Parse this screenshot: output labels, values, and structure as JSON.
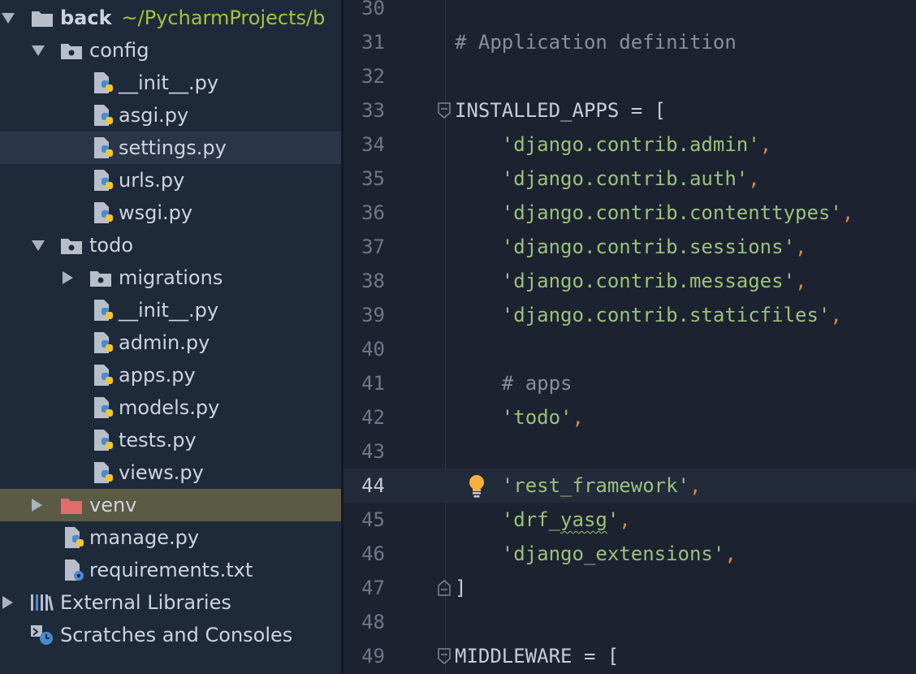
{
  "project_tree": {
    "root": {
      "name": "back",
      "path": "~/PycharmProjects/b"
    },
    "config": {
      "name": "config",
      "files": [
        "__init__.py",
        "asgi.py",
        "settings.py",
        "urls.py",
        "wsgi.py"
      ]
    },
    "todo": {
      "name": "todo",
      "migrations": "migrations",
      "files": [
        "__init__.py",
        "admin.py",
        "apps.py",
        "models.py",
        "tests.py",
        "views.py"
      ]
    },
    "venv": "venv",
    "root_files": [
      "manage.py",
      "requirements.txt"
    ],
    "external_libraries": "External Libraries",
    "scratches": "Scratches and Consoles",
    "selected_file": "settings.py"
  },
  "editor": {
    "current_line": "44",
    "lines": [
      {
        "num": "30",
        "tokens": []
      },
      {
        "num": "31",
        "tokens": [
          {
            "t": "# Application definition",
            "c": "comment"
          }
        ]
      },
      {
        "num": "32",
        "tokens": []
      },
      {
        "num": "33",
        "tokens": [
          {
            "t": "INSTALLED_APPS = [",
            "c": "plain"
          }
        ]
      },
      {
        "num": "34",
        "tokens": [
          {
            "t": "    ",
            "c": "plain"
          },
          {
            "t": "'django.contrib.admin'",
            "c": "str"
          },
          {
            "t": ",",
            "c": "punct"
          }
        ]
      },
      {
        "num": "35",
        "tokens": [
          {
            "t": "    ",
            "c": "plain"
          },
          {
            "t": "'django.contrib.auth'",
            "c": "str"
          },
          {
            "t": ",",
            "c": "punct"
          }
        ]
      },
      {
        "num": "36",
        "tokens": [
          {
            "t": "    ",
            "c": "plain"
          },
          {
            "t": "'django.contrib.contenttypes'",
            "c": "str"
          },
          {
            "t": ",",
            "c": "punct"
          }
        ]
      },
      {
        "num": "37",
        "tokens": [
          {
            "t": "    ",
            "c": "plain"
          },
          {
            "t": "'django.contrib.sessions'",
            "c": "str"
          },
          {
            "t": ",",
            "c": "punct"
          }
        ]
      },
      {
        "num": "38",
        "tokens": [
          {
            "t": "    ",
            "c": "plain"
          },
          {
            "t": "'django.contrib.messages'",
            "c": "str"
          },
          {
            "t": ",",
            "c": "punct"
          }
        ]
      },
      {
        "num": "39",
        "tokens": [
          {
            "t": "    ",
            "c": "plain"
          },
          {
            "t": "'django.contrib.staticfiles'",
            "c": "str"
          },
          {
            "t": ",",
            "c": "punct"
          }
        ]
      },
      {
        "num": "40",
        "tokens": []
      },
      {
        "num": "41",
        "tokens": [
          {
            "t": "    ",
            "c": "plain"
          },
          {
            "t": "# apps",
            "c": "comment"
          }
        ]
      },
      {
        "num": "42",
        "tokens": [
          {
            "t": "    ",
            "c": "plain"
          },
          {
            "t": "'todo'",
            "c": "str"
          },
          {
            "t": ",",
            "c": "punct"
          }
        ]
      },
      {
        "num": "43",
        "tokens": []
      },
      {
        "num": "44",
        "tokens": [
          {
            "t": "    ",
            "c": "plain"
          },
          {
            "t": "'rest_framework'",
            "c": "str"
          },
          {
            "t": ",",
            "c": "punct"
          }
        ]
      },
      {
        "num": "45",
        "tokens": [
          {
            "t": "    ",
            "c": "plain"
          },
          {
            "t": "'drf_",
            "c": "str"
          },
          {
            "t": "yasg",
            "c": "str wavy"
          },
          {
            "t": "'",
            "c": "str"
          },
          {
            "t": ",",
            "c": "punct"
          }
        ]
      },
      {
        "num": "46",
        "tokens": [
          {
            "t": "    ",
            "c": "plain"
          },
          {
            "t": "'django_extensions'",
            "c": "str"
          },
          {
            "t": ",",
            "c": "punct"
          }
        ]
      },
      {
        "num": "47",
        "tokens": [
          {
            "t": "]",
            "c": "plain"
          }
        ]
      },
      {
        "num": "48",
        "tokens": []
      },
      {
        "num": "49",
        "tokens": [
          {
            "t": "MIDDLEWARE = [",
            "c": "plain"
          }
        ]
      }
    ]
  },
  "colors": {
    "tree_bg": "#1e2a3a",
    "editor_bg": "#1d2231",
    "string": "#98c379",
    "comment": "#888f9c",
    "punct": "#d48a3c",
    "path": "#a8c23a",
    "excluded_folder": "#e06c6c"
  }
}
